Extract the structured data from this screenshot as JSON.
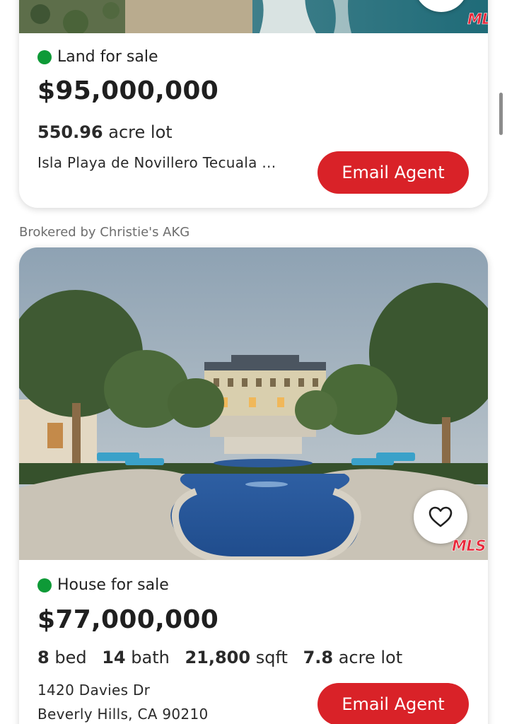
{
  "listings": [
    {
      "status": "Land for sale",
      "price": "$95,000,000",
      "lot_value": "550.96",
      "lot_unit": "acre lot",
      "address_line1": "Isla Playa de Novillero Tecuala ...",
      "email_label": "Email Agent",
      "mls_badge": "MLS"
    },
    {
      "broker": "Brokered by Christie's AKG",
      "status": "House for sale",
      "price": "$77,000,000",
      "beds_value": "8",
      "beds_unit": "bed",
      "baths_value": "14",
      "baths_unit": "bath",
      "sqft_value": "21,800",
      "sqft_unit": "sqft",
      "lot_value": "7.8",
      "lot_unit": "acre lot",
      "address_line1": "1420 Davies Dr",
      "address_line2": "Beverly Hills, CA 90210",
      "email_label": "Email Agent",
      "mls_badge": "MLS"
    }
  ],
  "colors": {
    "accent": "#d92228",
    "status_dot": "#0e9a37",
    "text": "#222222",
    "muted": "#6d6d6d"
  },
  "icons": {
    "favorite": "heart-outline-icon"
  }
}
